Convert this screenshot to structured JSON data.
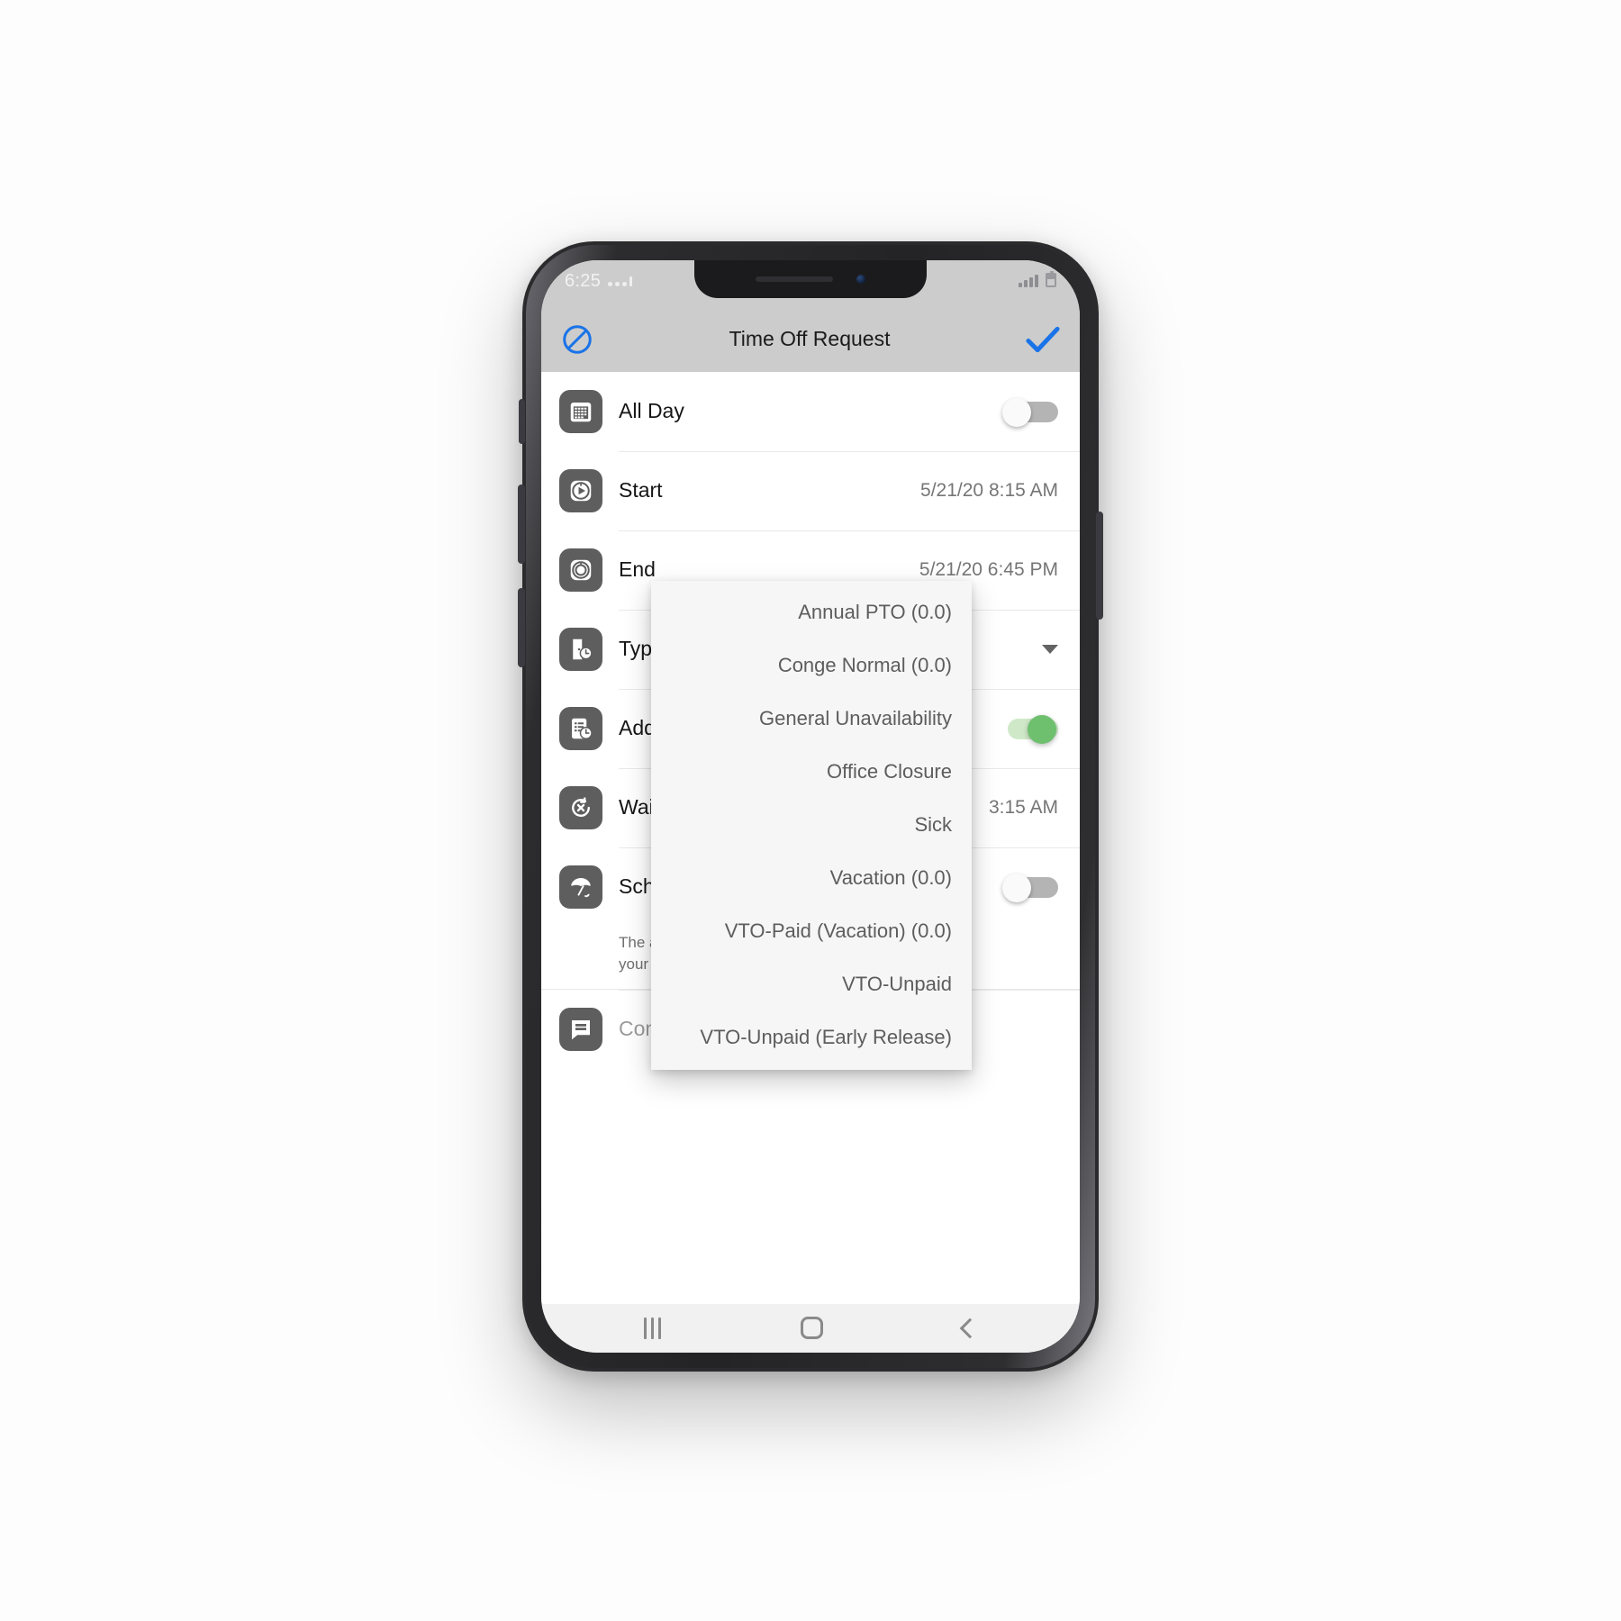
{
  "status_bar": {
    "time": "6:25",
    "signal_icon": "signal-bars-icon",
    "battery_icon": "battery-icon"
  },
  "app_bar": {
    "title": "Time Off Request",
    "cancel_icon": "cancel-circle-icon",
    "confirm_icon": "checkmark-icon",
    "cancel_color": "#1a73e8",
    "confirm_color": "#1a73e8"
  },
  "form": {
    "rows": [
      {
        "label": "All Day",
        "icon": "calendar-icon",
        "control": "toggle",
        "toggle_on": false
      },
      {
        "label": "Start",
        "icon": "clock-start-icon",
        "control": "value",
        "value": "5/21/20 8:15 AM"
      },
      {
        "label": "End",
        "icon": "clock-end-icon",
        "control": "value",
        "value": "5/21/20 6:45 PM"
      },
      {
        "label": "Type",
        "icon": "door-clock-icon",
        "control": "select",
        "value": ""
      },
      {
        "label": "Add to",
        "icon": "clipboard-clock-icon",
        "control": "toggle",
        "toggle_on": true
      },
      {
        "label": "Waitlis",
        "icon": "cancel-clock-icon",
        "control": "value",
        "value": "3:15 AM"
      },
      {
        "label": "Sched",
        "icon": "umbrella-icon",
        "control": "toggle",
        "toggle_on": false
      }
    ],
    "hint_line1": "The adm",
    "hint_line2": "your tim",
    "comment": {
      "icon": "comment-icon",
      "placeholder": "Comm"
    }
  },
  "dropdown": {
    "options": [
      "Annual PTO (0.0)",
      "Conge Normal (0.0)",
      "General Unavailability",
      "Office Closure",
      "Sick",
      "Vacation (0.0)",
      "VTO-Paid (Vacation) (0.0)",
      "VTO-Unpaid",
      "VTO-Unpaid (Early Release)"
    ]
  },
  "nav_bar": {
    "recent_icon": "recents-icon",
    "home_icon": "home-icon",
    "back_icon": "back-icon"
  }
}
